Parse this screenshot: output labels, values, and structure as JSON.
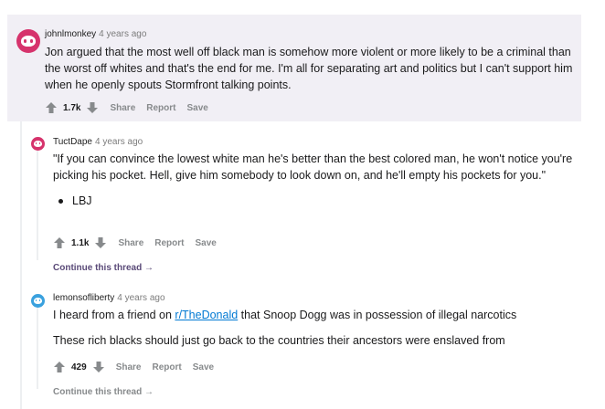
{
  "comments": [
    {
      "author": "johnlmonkey",
      "time": "4 years ago",
      "body": "Jon argued that the most well off black man is somehow more violent or more likely to be a criminal than the worst off whites and that's the end for me. I'm all for separating art and politics but I can't support him when he openly spouts Stormfront talking points.",
      "score": "1.7k",
      "actions": [
        "Share",
        "Report",
        "Save"
      ]
    },
    {
      "author": "TuctDape",
      "time": "4 years ago",
      "body": "\"If you can convince the lowest white man he's better than the best colored man, he won't notice you're picking his pocket. Hell, give him somebody to look down on, and he'll empty his pockets for you.\"",
      "bullet": "LBJ",
      "score": "1.1k",
      "actions": [
        "Share",
        "Report",
        "Save"
      ],
      "continue": "Continue this thread"
    },
    {
      "author": "lemonsofliberty",
      "time": "4 years ago",
      "body_prefix": "I heard from a friend on ",
      "body_link": "r/TheDonald",
      "body_suffix": " that Snoop Dogg was in possession of illegal narcotics",
      "body2": "These rich blacks should just go back to the countries their ancestors were enslaved from",
      "score": "429",
      "actions": [
        "Share",
        "Report",
        "Save"
      ],
      "continue": "Continue this thread"
    }
  ],
  "colors": {
    "highlight_bg": "#f1eff5",
    "avatar_red": "#d6336c",
    "avatar_blue": "#3aa1de",
    "link": "#0079d3",
    "continue": "#5a4a78"
  }
}
